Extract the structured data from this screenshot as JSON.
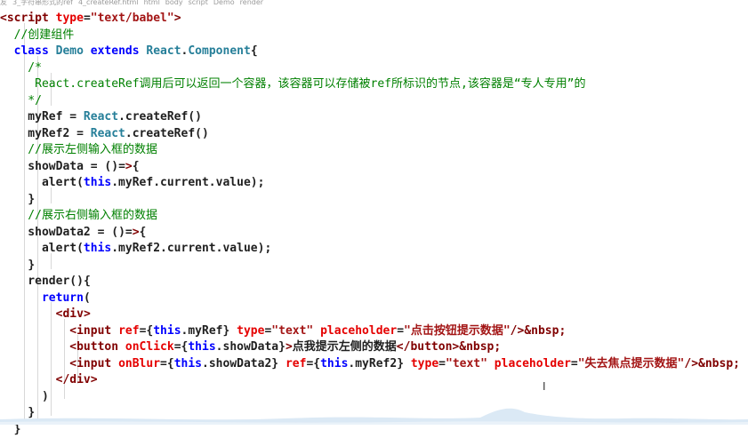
{
  "breadcrumb": {
    "items": [
      "友",
      "3_字符串形式的ref",
      "4_createRef.html",
      "html",
      "body",
      "script",
      "Demo",
      "render"
    ]
  },
  "code": {
    "lines": [
      "<script type=\"text/babel\">",
      "  //创建组件",
      "  class Demo extends React.Component{",
      "    /*",
      "     React.createRef调用后可以返回一个容器，该容器可以存储被ref所标识的节点,该容器是“专人专用”的",
      "    */",
      "    myRef = React.createRef()",
      "    myRef2 = React.createRef()",
      "    //展示左侧输入框的数据",
      "    showData = ()=>{",
      "      alert(this.myRef.current.value);",
      "    }",
      "    //展示右侧输入框的数据",
      "    showData2 = ()=>{",
      "      alert(this.myRef2.current.value);",
      "    }",
      "    render(){",
      "      return(",
      "        <div>",
      "          <input ref={this.myRef} type=\"text\" placeholder=\"点击按钮提示数据\"/>&nbsp;",
      "          <button onClick={this.showData}>点我提示左侧的数据</button>&nbsp;",
      "          <input onBlur={this.showData2} ref={this.myRef2} type=\"text\" placeholder=\"失去焦点提示数据\"/>&nbsp;",
      "        </div>",
      "      )",
      "    }"
    ]
  },
  "colors": {
    "tag": "#800000",
    "attribute": "#e50000",
    "string": "#a31515",
    "keyword": "#0000ff",
    "type": "#267f99",
    "comment": "#008000"
  },
  "icons": {
    "text_cursor": "i-beam-cursor-icon"
  }
}
